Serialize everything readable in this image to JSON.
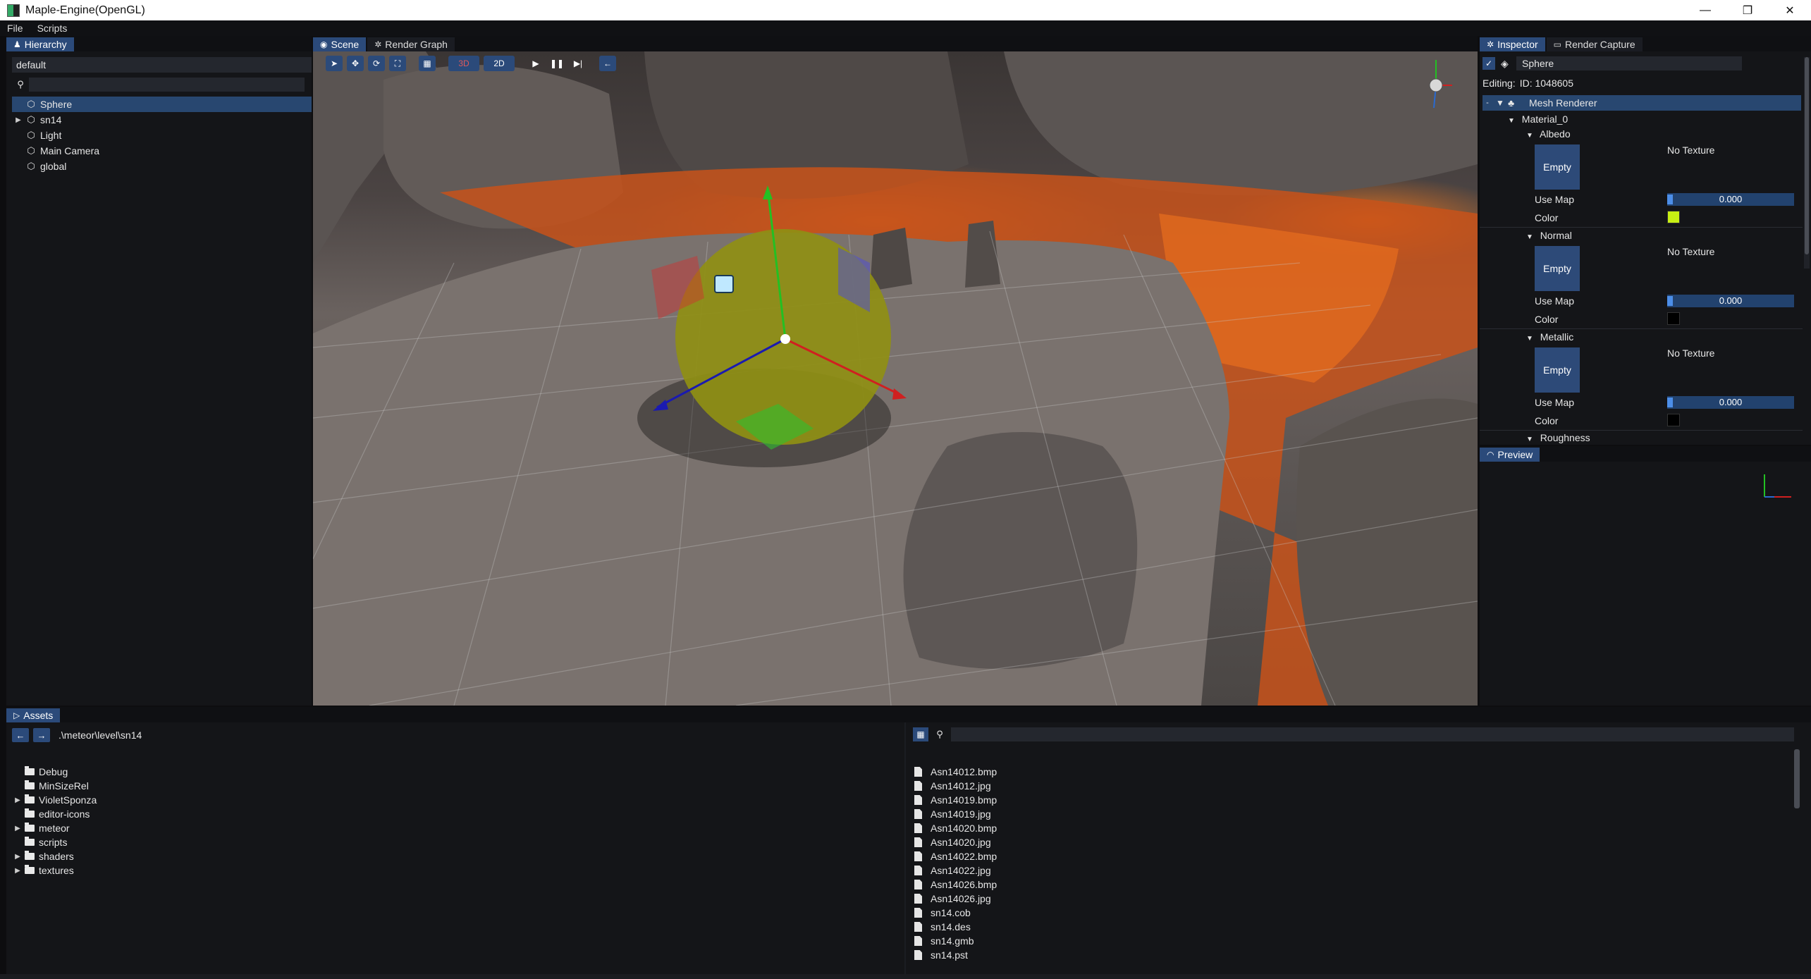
{
  "window": {
    "title": "Maple-Engine(OpenGL)",
    "minimize": "—",
    "restore": "❐",
    "close": "✕"
  },
  "menu": [
    "File",
    "Scripts"
  ],
  "hierarchy": {
    "tab": "Hierarchy",
    "scene_dropdown": "default",
    "search_placeholder": "",
    "items": [
      {
        "label": "Sphere",
        "selected": true,
        "expandable": false
      },
      {
        "label": "sn14",
        "selected": false,
        "expandable": true
      },
      {
        "label": "Light",
        "selected": false,
        "expandable": false
      },
      {
        "label": "Main Camera",
        "selected": false,
        "expandable": false
      },
      {
        "label": "global",
        "selected": false,
        "expandable": false
      }
    ]
  },
  "scene": {
    "tabs": [
      "Scene",
      "Render Graph"
    ],
    "active_tab": "Scene",
    "toolbar": {
      "mode_3d": "3D",
      "mode_2d": "2D"
    }
  },
  "inspector": {
    "tabs": [
      "Inspector",
      "Render Capture"
    ],
    "entity_name": "Sphere",
    "editing_label": "Editing:",
    "editing_id": "ID: 1048605",
    "component": "Mesh Renderer",
    "material": "Material_0",
    "sections": [
      {
        "name": "Albedo",
        "thumb": "Empty",
        "texture": "No Texture",
        "use_map_label": "Use Map",
        "use_map": "0.000",
        "color_label": "Color",
        "color": "#c8ef14"
      },
      {
        "name": "Normal",
        "thumb": "Empty",
        "texture": "No Texture",
        "use_map_label": "Use Map",
        "use_map": "0.000",
        "color_label": "Color",
        "color": "#000000"
      },
      {
        "name": "Metallic",
        "thumb": "Empty",
        "texture": "No Texture",
        "use_map_label": "Use Map",
        "use_map": "0.000",
        "color_label": "Color",
        "color": "#000000"
      }
    ],
    "next_section": "Roughness"
  },
  "preview": {
    "tab": "Preview"
  },
  "assets": {
    "tab": "Assets",
    "path": ".\\meteor\\level\\sn14",
    "folders": [
      {
        "label": "Debug",
        "expandable": false
      },
      {
        "label": "MinSizeRel",
        "expandable": false
      },
      {
        "label": "VioletSponza",
        "expandable": true
      },
      {
        "label": "editor-icons",
        "expandable": false
      },
      {
        "label": "meteor",
        "expandable": true
      },
      {
        "label": "scripts",
        "expandable": false
      },
      {
        "label": "shaders",
        "expandable": true
      },
      {
        "label": "textures",
        "expandable": true
      }
    ],
    "files": [
      "Asn14012.bmp",
      "Asn14012.jpg",
      "Asn14019.bmp",
      "Asn14019.jpg",
      "Asn14020.bmp",
      "Asn14020.jpg",
      "Asn14022.bmp",
      "Asn14022.jpg",
      "Asn14026.bmp",
      "Asn14026.jpg",
      "sn14.cob",
      "sn14.des",
      "sn14.gmb",
      "sn14.pst"
    ]
  },
  "colors": {
    "accent": "#2b4a7a",
    "selection": "#284770",
    "panel": "#141518",
    "field": "#24272e"
  }
}
